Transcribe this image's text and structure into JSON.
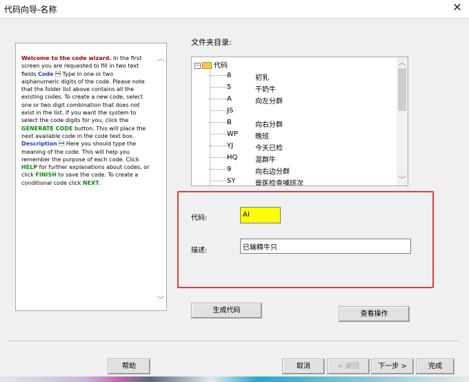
{
  "window": {
    "title": "代码向导-名称",
    "close_glyph": "✕"
  },
  "help": {
    "welcome": "Welcome to the code wizard.",
    "p1": " In the first screen you are requested to fill in two text fields ",
    "code_word": "Code",
    "p2": " \u0001 Type in one or two alphanumeric digits of the code. Please note that the folder list above contains all the existing codes. To create a new code, select one or two digit combination that does not exist in the list. If you want the system to select the code digits for you, click the ",
    "generate_word": "GENERATE CODE",
    "p3": " button. This will place the next available code in the code text box. ",
    "description_word": "Description",
    "p4": " \u0001 Here you should type the meaning of the code. This will help you remember the purpose of each code. Click ",
    "help_word": "HELP",
    "p5": " for further explanations about codes, or click ",
    "finish_word": "FINISH",
    "p6": " to save the code. To create a conditional code click ",
    "next_word": "NEXT",
    "p7": "."
  },
  "folders": {
    "label": "文件夹目录:",
    "root_toggle": "−",
    "root_label": "代码",
    "items": [
      {
        "code": "8",
        "desc": "初乳"
      },
      {
        "code": "5",
        "desc": "干奶牛"
      },
      {
        "code": "A",
        "desc": "向左分群"
      },
      {
        "code": "JS",
        "desc": ""
      },
      {
        "code": "B",
        "desc": "向右分群"
      },
      {
        "code": "WP",
        "desc": "晚班"
      },
      {
        "code": "YJ",
        "desc": "今天已检"
      },
      {
        "code": "HQ",
        "desc": "混群牛"
      },
      {
        "code": "9",
        "desc": "向右边分群"
      },
      {
        "code": "SY",
        "desc": "兽医检查哺班次"
      }
    ]
  },
  "form": {
    "code_label": "代码:",
    "code_value": "AI",
    "desc_label": "描述:",
    "desc_value": "已输精牛只"
  },
  "buttons": {
    "generate": "生成代码",
    "view_ops": "查看操作",
    "help": "帮助",
    "cancel": "取消",
    "back": "< 返回",
    "next": "下一步 >",
    "finish": "完成"
  },
  "colors": {
    "highlight": "#ffff00",
    "annotation": "#e53935"
  }
}
